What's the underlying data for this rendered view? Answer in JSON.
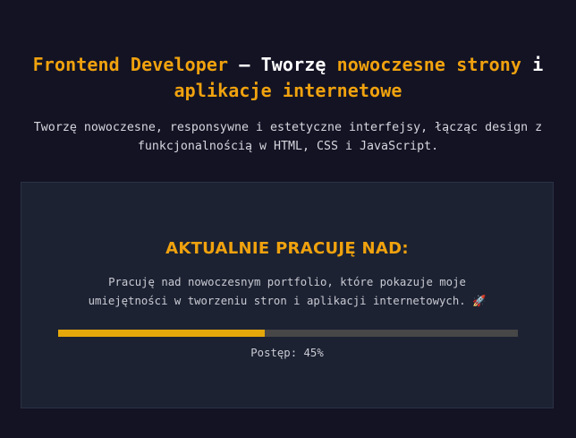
{
  "hero": {
    "title_part1": "Frontend Developer",
    "title_sep": " – ",
    "title_part2": "Tworzę",
    "title_part3": " nowoczesne strony",
    "title_part4": " i",
    "title_line2": "aplikacje internetowe"
  },
  "intro": {
    "line1": "Tworzę nowoczesne, responsywne i estetyczne interfejsy, łącząc design z",
    "line2": "funkcjonalnością w HTML, CSS i JavaScript."
  },
  "current_work": {
    "title": "AKTUALNIE PRACUJĘ NAD:",
    "desc_line1": "Pracuję nad nowoczesnym portfolio, które pokazuje moje",
    "desc_line2": "umiejętności w tworzeniu stron i aplikacji internetowych. 🚀",
    "progress_percent": 45,
    "progress_label": "Postęp: 45%"
  },
  "colors": {
    "background": "#131324",
    "accent": "#f0a20e",
    "card": "#1c2232",
    "progress_track": "#474747",
    "progress_fill": "#e4a80b"
  }
}
